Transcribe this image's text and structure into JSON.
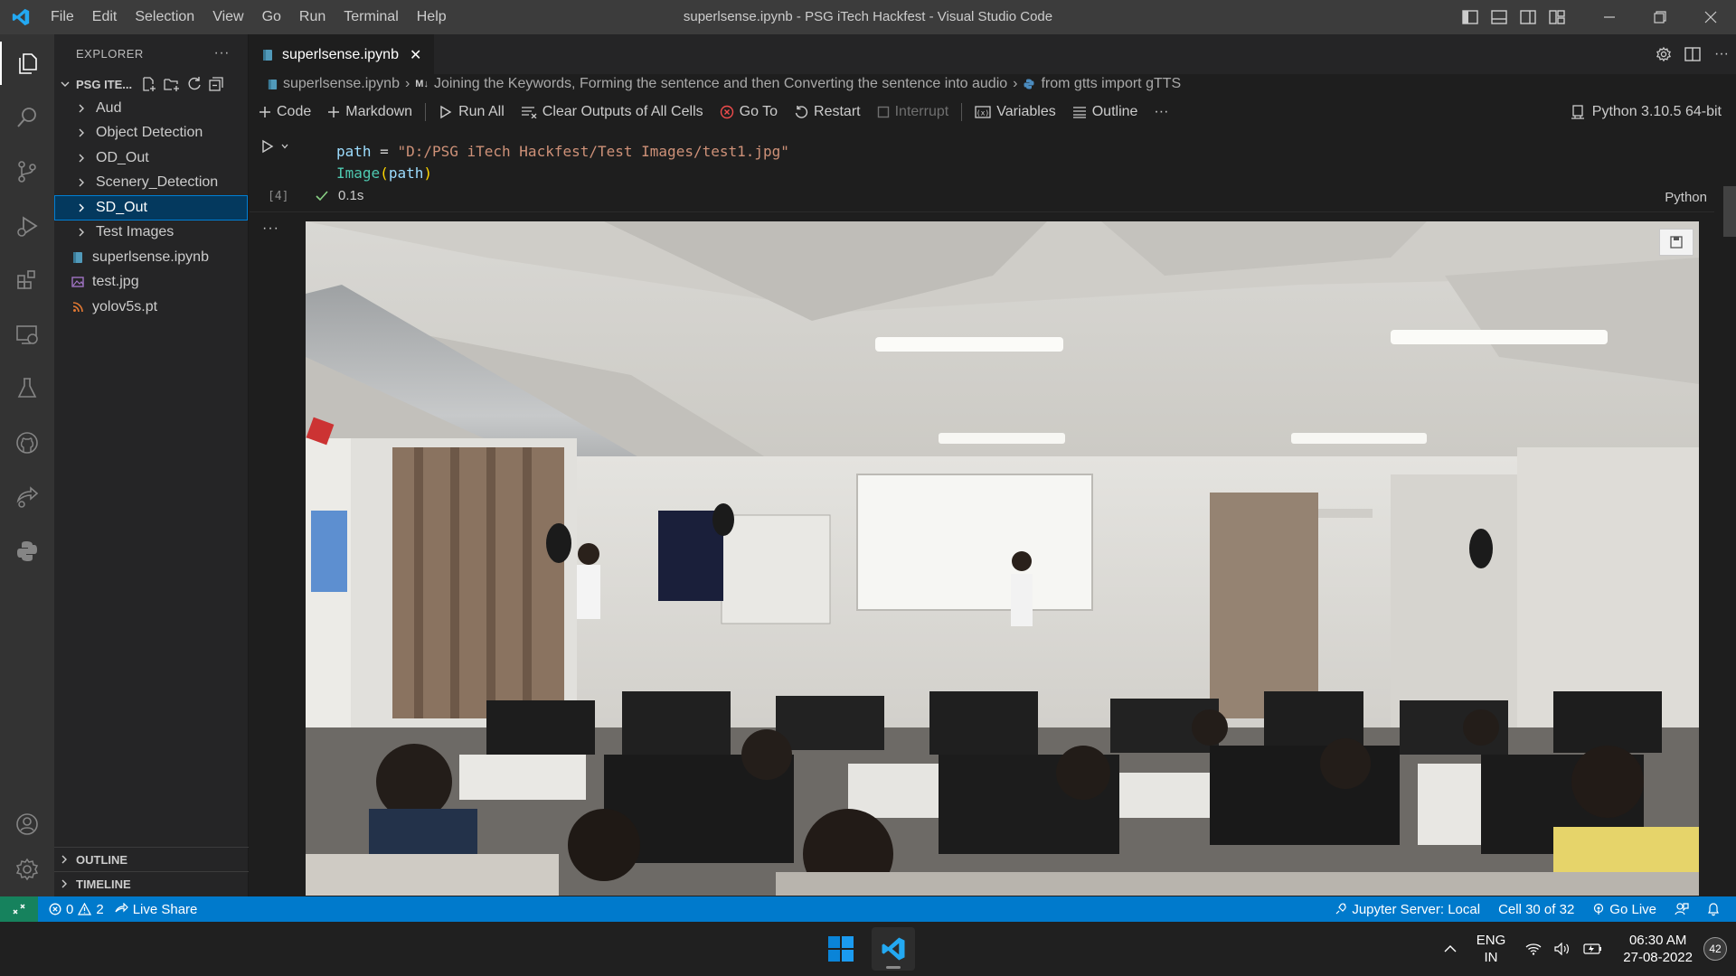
{
  "window": {
    "title": "superlsense.ipynb - PSG iTech Hackfest - Visual Studio Code",
    "menu": [
      "File",
      "Edit",
      "Selection",
      "View",
      "Go",
      "Run",
      "Terminal",
      "Help"
    ]
  },
  "sidebar": {
    "header": "EXPLORER",
    "more": "···",
    "folder": "PSG ITE...",
    "items": [
      {
        "label": "Aud",
        "type": "folder"
      },
      {
        "label": "Object Detection",
        "type": "folder"
      },
      {
        "label": "OD_Out",
        "type": "folder"
      },
      {
        "label": "Scenery_Detection",
        "type": "folder"
      },
      {
        "label": "SD_Out",
        "type": "folder",
        "selected": true
      },
      {
        "label": "Test Images",
        "type": "folder"
      },
      {
        "label": "superlsense.ipynb",
        "type": "notebook"
      },
      {
        "label": "test.jpg",
        "type": "image"
      },
      {
        "label": "yolov5s.pt",
        "type": "rss"
      }
    ],
    "sections": {
      "outline": "OUTLINE",
      "timeline": "TIMELINE"
    }
  },
  "editor": {
    "tab": {
      "label": "superlsense.ipynb",
      "close": "✕"
    },
    "breadcrumb": {
      "file": "superlsense.ipynb",
      "md_prefix": "M↓",
      "section": "Joining the Keywords, Forming the sentence and then Converting the sentence into audio",
      "cell": "from gtts import gTTS"
    },
    "toolbar": {
      "code": "Code",
      "markdown": "Markdown",
      "run_all": "Run All",
      "clear_outputs": "Clear Outputs of All Cells",
      "go_to": "Go To",
      "restart": "Restart",
      "interrupt": "Interrupt",
      "variables": "Variables",
      "outline": "Outline",
      "more": "···",
      "kernel": "Python 3.10.5 64-bit"
    },
    "cell": {
      "line1": {
        "var": "path",
        "op": " = ",
        "str": "\"D:/PSG iTech Hackfest/Test Images/test1.jpg\""
      },
      "line2": {
        "fn": "Image",
        "open": "(",
        "arg": "path",
        "close": ")"
      },
      "exec_count": "[4]",
      "duration": "0.1s",
      "language": "Python",
      "output_more": "···"
    }
  },
  "statusbar": {
    "errors": "0",
    "warnings": "2",
    "live_share": "Live Share",
    "jupyter": "Jupyter Server: Local",
    "cell_pos": "Cell 30 of 32",
    "go_live": "Go Live"
  },
  "taskbar": {
    "lang_line1": "ENG",
    "lang_line2": "IN",
    "time": "06:30 AM",
    "date": "27-08-2022",
    "notifications": "42"
  },
  "colors": {
    "accent": "#007acc",
    "remote": "#16825d",
    "selection": "#04395e",
    "success": "#89d185",
    "error": "#f14c4c"
  }
}
